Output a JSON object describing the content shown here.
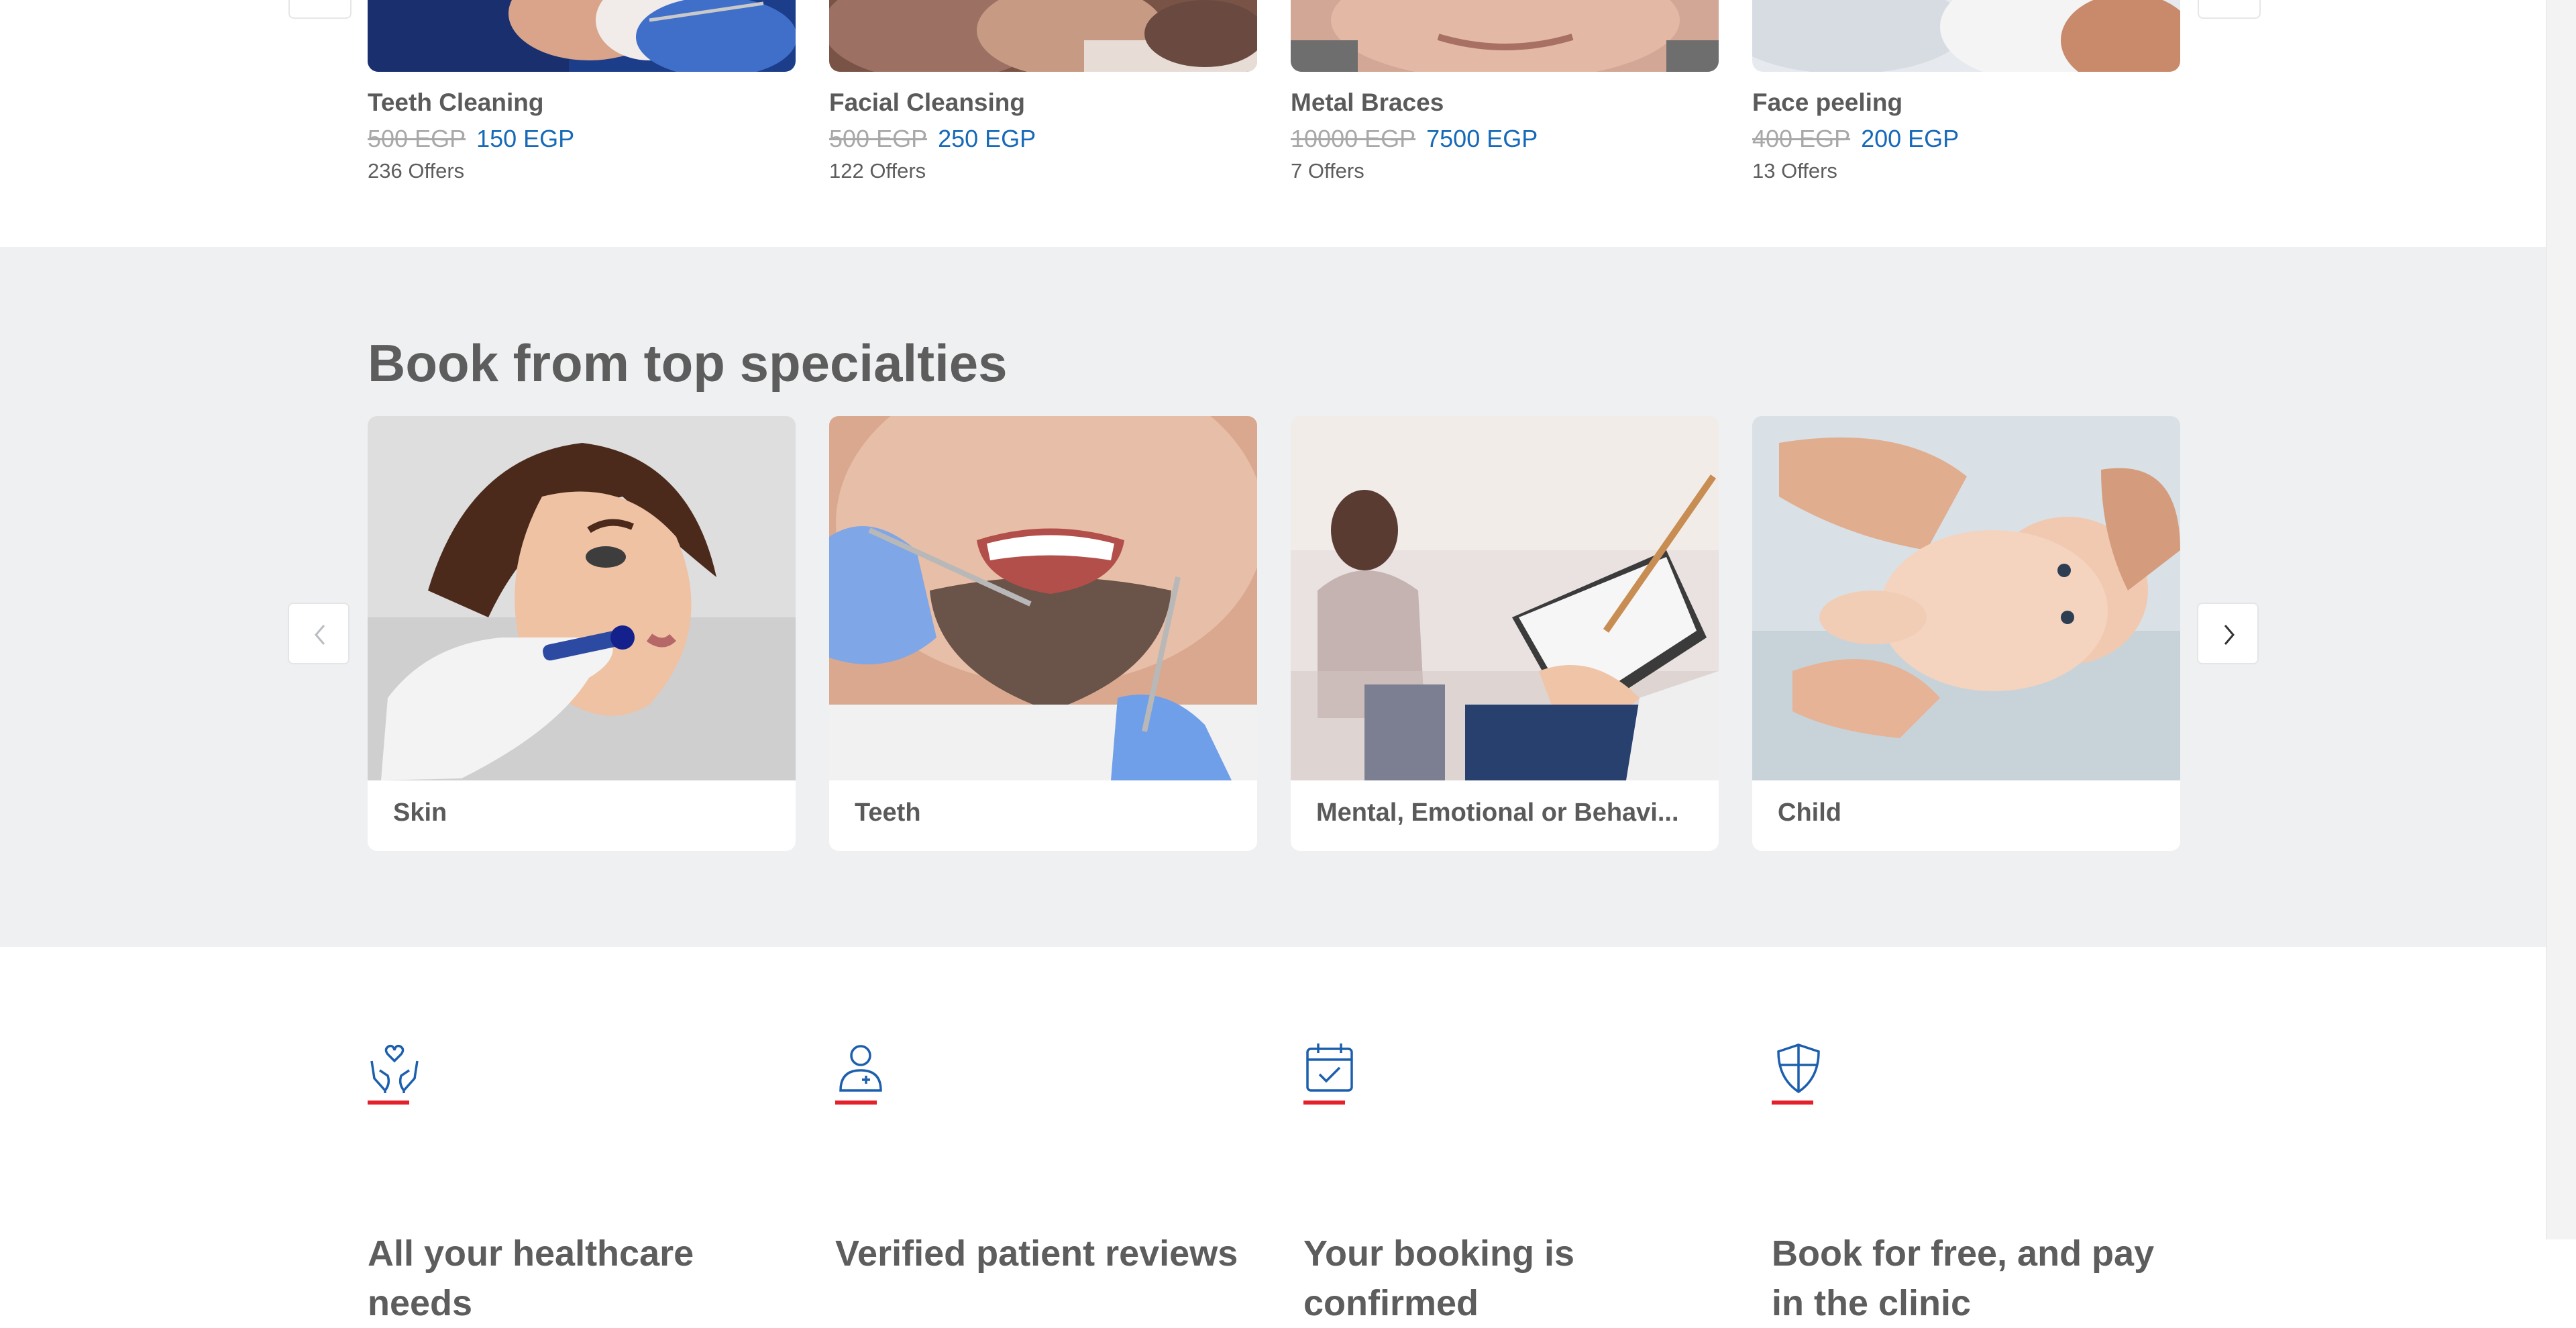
{
  "offers": [
    {
      "name": "Teeth Cleaning",
      "old_price": "500 EGP",
      "new_price": "150 EGP",
      "count": "236 Offers"
    },
    {
      "name": "Facial Cleansing",
      "old_price": "500 EGP",
      "new_price": "250 EGP",
      "count": "122 Offers"
    },
    {
      "name": "Metal Braces",
      "old_price": "10000 EGP",
      "new_price": "7500 EGP",
      "count": "7 Offers"
    },
    {
      "name": "Face peeling",
      "old_price": "400 EGP",
      "new_price": "200 EGP",
      "count": "13 Offers"
    }
  ],
  "specialties": {
    "title": "Book from top specialties",
    "items": [
      {
        "label": "Skin"
      },
      {
        "label": "Teeth"
      },
      {
        "label": "Mental, Emotional or Behavi..."
      },
      {
        "label": "Child"
      }
    ]
  },
  "features": [
    {
      "text": "All your healthcare needs",
      "icon": "hands-heart-icon"
    },
    {
      "text": "Verified patient reviews",
      "icon": "patient-verified-icon"
    },
    {
      "text": "Your booking is confirmed",
      "icon": "calendar-check-icon"
    },
    {
      "text": "Book for free, and pay in the clinic",
      "icon": "shield-icon"
    }
  ],
  "colors": {
    "accent_blue": "#1669b8",
    "accent_red": "#e4202a",
    "section_bg": "#eef0f2",
    "text": "#5d5d5d"
  }
}
